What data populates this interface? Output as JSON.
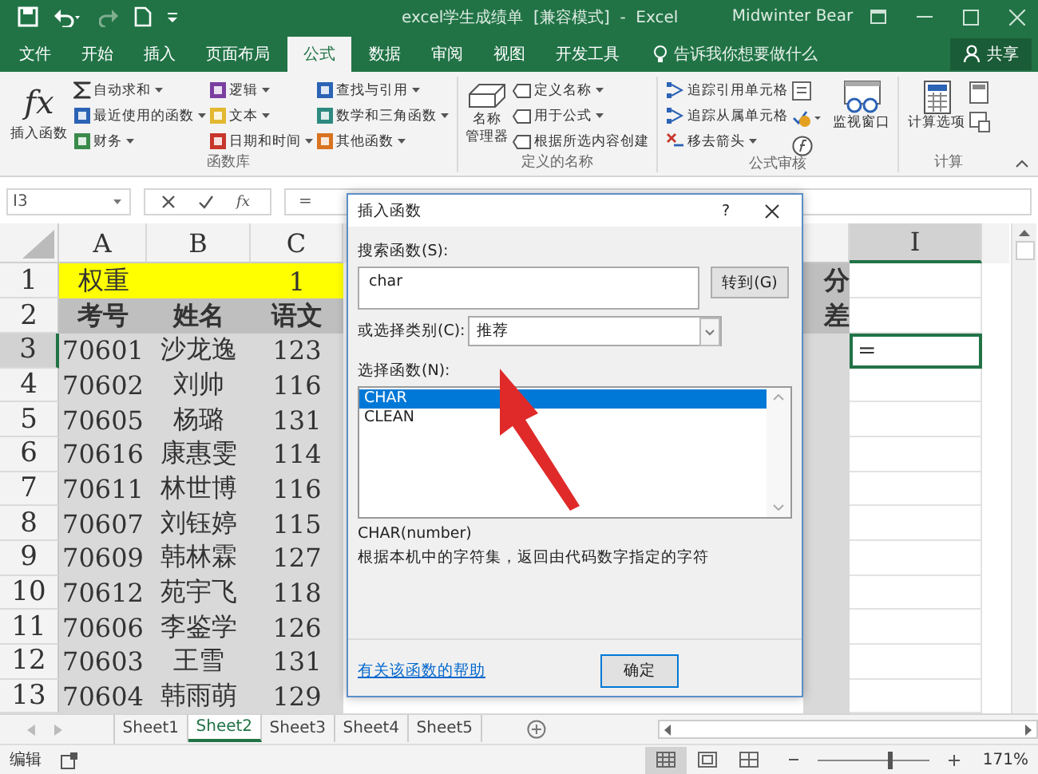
{
  "window": {
    "title": "excel学生成绩单  [兼容模式]  -  Excel",
    "user": "Midwinter Bear"
  },
  "tabs": [
    {
      "label": "文件",
      "selected": false
    },
    {
      "label": "开始",
      "selected": false
    },
    {
      "label": "插入",
      "selected": false
    },
    {
      "label": "页面布局",
      "selected": false
    },
    {
      "label": "公式",
      "selected": true
    },
    {
      "label": "数据",
      "selected": false
    },
    {
      "label": "审阅",
      "selected": false
    },
    {
      "label": "视图",
      "selected": false
    },
    {
      "label": "开发工具",
      "selected": false
    }
  ],
  "tell_me": "告诉我你想要做什么",
  "share": "共享",
  "ribbon": {
    "function_library": {
      "label": "函数库",
      "insert_icon": "fx",
      "insert_label": "插入函数",
      "columns": [
        [
          {
            "label": "自动求和",
            "dropdown": true
          },
          {
            "label": "最近使用的函数",
            "dropdown": true
          },
          {
            "label": "财务",
            "dropdown": true
          }
        ],
        [
          {
            "label": "逻辑",
            "dropdown": true
          },
          {
            "label": "文本",
            "dropdown": true
          },
          {
            "label": "日期和时间",
            "dropdown": true
          }
        ],
        [
          {
            "label": "查找与引用",
            "dropdown": true
          },
          {
            "label": "数学和三角函数",
            "dropdown": true
          },
          {
            "label": "其他函数",
            "dropdown": true
          }
        ]
      ]
    },
    "defined_names": {
      "label": "定义的名称",
      "manager": [
        "名称",
        "管理器"
      ],
      "items": [
        {
          "label": "定义名称",
          "dropdown": true
        },
        {
          "label": "用于公式",
          "dropdown": true
        },
        {
          "label": "根据所选内容创建",
          "dropdown": false
        }
      ]
    },
    "auditing": {
      "label": "公式审核",
      "items": [
        {
          "label": "追踪引用单元格",
          "dropdown": false
        },
        {
          "label": "追踪从属单元格",
          "dropdown": false
        },
        {
          "label": "移去箭头",
          "dropdown": true
        }
      ],
      "watch": "监视窗口"
    },
    "calculation": {
      "label": "计算",
      "options": "计算选项"
    }
  },
  "formula_bar": {
    "name_box": "I3",
    "fx": "fx",
    "formula": "="
  },
  "columns": [
    {
      "label": "A",
      "selected": false
    },
    {
      "label": "B",
      "selected": false
    },
    {
      "label": "C",
      "selected": false
    },
    {
      "label": "I",
      "selected": true
    }
  ],
  "rows": [
    {
      "number": "1",
      "selected": false,
      "kind": "weight",
      "cells": [
        "权重",
        "1"
      ],
      "h": "分"
    },
    {
      "number": "2",
      "selected": false,
      "kind": "header",
      "cells": [
        "考号",
        "姓名",
        "语文"
      ],
      "h": "差"
    },
    {
      "number": "3",
      "selected": true,
      "kind": "data",
      "cells": [
        "70601",
        "沙龙逸",
        "123"
      ],
      "i": {
        "value": "=",
        "active": true
      }
    },
    {
      "number": "4",
      "selected": false,
      "kind": "data",
      "cells": [
        "70602",
        "刘帅",
        "116"
      ]
    },
    {
      "number": "5",
      "selected": false,
      "kind": "data",
      "cells": [
        "70605",
        "杨璐",
        "131"
      ]
    },
    {
      "number": "6",
      "selected": false,
      "kind": "data",
      "cells": [
        "70616",
        "康惠雯",
        "114"
      ]
    },
    {
      "number": "7",
      "selected": false,
      "kind": "data",
      "cells": [
        "70611",
        "林世博",
        "116"
      ]
    },
    {
      "number": "8",
      "selected": false,
      "kind": "data",
      "cells": [
        "70607",
        "刘钰婷",
        "115"
      ]
    },
    {
      "number": "9",
      "selected": false,
      "kind": "data",
      "cells": [
        "70609",
        "韩林霖",
        "127"
      ]
    },
    {
      "number": "10",
      "selected": false,
      "kind": "data",
      "cells": [
        "70612",
        "苑宇飞",
        "118"
      ]
    },
    {
      "number": "11",
      "selected": false,
      "kind": "data",
      "cells": [
        "70606",
        "李鉴学",
        "126"
      ]
    },
    {
      "number": "12",
      "selected": false,
      "kind": "data",
      "cells": [
        "70603",
        "王雪",
        "131"
      ]
    },
    {
      "number": "13",
      "selected": false,
      "kind": "data",
      "cells": [
        "70604",
        "韩雨萌",
        "129"
      ]
    }
  ],
  "dialog": {
    "title": "插入函数",
    "help": "?",
    "search_label": "搜索函数(S):",
    "search_value": "char",
    "go": "转到(G)",
    "category_label": "或选择类别(C):",
    "category": "推荐",
    "list_label": "选择函数(N):",
    "functions": [
      {
        "name": "CHAR",
        "selected": true
      },
      {
        "name": "CLEAN",
        "selected": false
      }
    ],
    "signature": "CHAR(number)",
    "description": "根据本机中的字符集，返回由代码数字指定的字符",
    "help_link": "有关该函数的帮助",
    "ok": "确定"
  },
  "sheets": [
    {
      "label": "Sheet1",
      "selected": false
    },
    {
      "label": "Sheet2",
      "selected": true
    },
    {
      "label": "Sheet3",
      "selected": false
    },
    {
      "label": "Sheet4",
      "selected": false
    },
    {
      "label": "Sheet5",
      "selected": false
    }
  ],
  "status_bar": {
    "mode": "编辑",
    "views": [
      {
        "kind": "normal",
        "selected": true
      },
      {
        "kind": "page_layout",
        "selected": false
      },
      {
        "kind": "page_break",
        "selected": false
      }
    ],
    "zoom": "171%",
    "zoom_slider": {
      "level": 0.63
    }
  }
}
